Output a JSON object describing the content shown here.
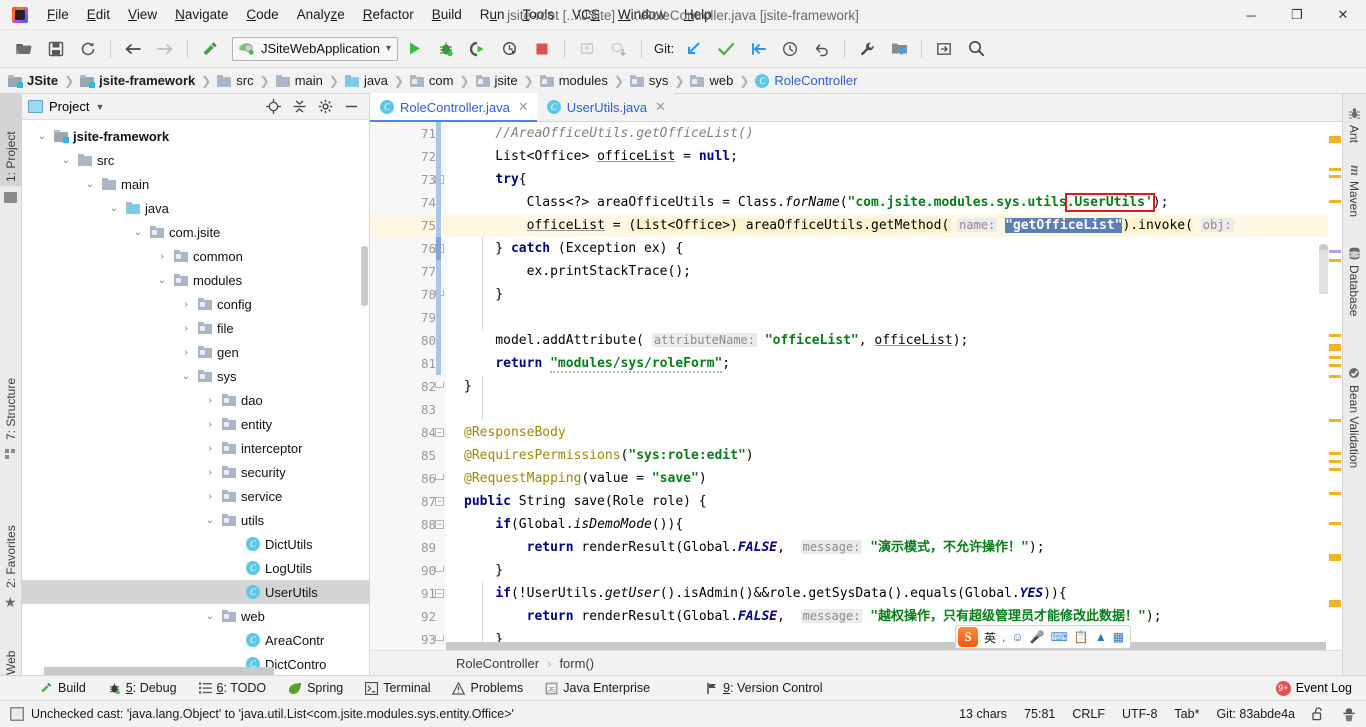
{
  "window": {
    "title": "jsite-root [...\\JSite] - ...\\RoleController.java [jsite-framework]",
    "minimize": "─",
    "maximize": "❐",
    "close": "✕"
  },
  "menubar": [
    {
      "label": "File",
      "mnemonic": "F"
    },
    {
      "label": "Edit",
      "mnemonic": "E"
    },
    {
      "label": "View",
      "mnemonic": "V"
    },
    {
      "label": "Navigate",
      "mnemonic": "N"
    },
    {
      "label": "Code",
      "mnemonic": "C"
    },
    {
      "label": "Analyze",
      "mnemonic": "z"
    },
    {
      "label": "Refactor",
      "mnemonic": "R"
    },
    {
      "label": "Build",
      "mnemonic": "B"
    },
    {
      "label": "Run",
      "mnemonic": "u"
    },
    {
      "label": "Tools",
      "mnemonic": "T"
    },
    {
      "label": "VCS",
      "mnemonic": "S"
    },
    {
      "label": "Window",
      "mnemonic": "W"
    },
    {
      "label": "Help",
      "mnemonic": "H"
    }
  ],
  "toolbar": {
    "run_config": "JSiteWebApplication",
    "git_label": "Git:",
    "icons": [
      "open-folder-icon",
      "save-all-icon",
      "sync-icon",
      "back-arrow-icon",
      "forward-arrow-icon",
      "build-hammer-icon"
    ],
    "run_icons": [
      "run-icon",
      "debug-icon",
      "run-with-coverage-icon",
      "profile-icon",
      "stop-icon",
      "attach-icon",
      "module-down-icon"
    ],
    "git_icons": [
      "update-project-icon",
      "commit-icon",
      "push-icon",
      "history-icon",
      "rollback-icon"
    ],
    "right_icons": [
      "settings-wrench-icon",
      "project-structure-icon",
      "select-in-icon",
      "search-everywhere-icon"
    ]
  },
  "breadcrumb": [
    {
      "label": "JSite",
      "icon": "module-folder-icon",
      "bold": true
    },
    {
      "label": "jsite-framework",
      "icon": "module-folder-icon",
      "bold": true
    },
    {
      "label": "src",
      "icon": "folder-icon"
    },
    {
      "label": "main",
      "icon": "folder-icon"
    },
    {
      "label": "java",
      "icon": "source-root-icon"
    },
    {
      "label": "com",
      "icon": "package-icon"
    },
    {
      "label": "jsite",
      "icon": "package-icon"
    },
    {
      "label": "modules",
      "icon": "package-icon"
    },
    {
      "label": "sys",
      "icon": "package-icon"
    },
    {
      "label": "web",
      "icon": "package-icon"
    },
    {
      "label": "RoleController",
      "icon": "class-icon",
      "blue": true
    }
  ],
  "left_strip": [
    {
      "label": "1: Project",
      "selected": true
    },
    {
      "label": "7: Structure",
      "selected": false
    },
    {
      "label": "2: Favorites",
      "selected": false
    },
    {
      "label": "Web",
      "selected": false
    }
  ],
  "right_strip": [
    {
      "label": "Ant",
      "icon": "ant-icon"
    },
    {
      "label": "Maven",
      "icon": "maven-icon"
    },
    {
      "label": "Database",
      "icon": "database-icon"
    },
    {
      "label": "Bean Validation",
      "icon": "bean-validation-icon"
    }
  ],
  "project_panel": {
    "title": "Project",
    "header_icons": [
      "locate-icon",
      "collapse-all-icon",
      "settings-gear-icon",
      "hide-icon"
    ],
    "tree": [
      {
        "label": "jsite-framework",
        "depth": 1,
        "twist": "down",
        "icon": "module-folder-icon",
        "bold": true,
        "selected": false
      },
      {
        "label": "src",
        "depth": 2,
        "twist": "down",
        "icon": "folder-icon",
        "bold": false,
        "selected": false
      },
      {
        "label": "main",
        "depth": 3,
        "twist": "down",
        "icon": "folder-icon",
        "bold": false,
        "selected": false
      },
      {
        "label": "java",
        "depth": 4,
        "twist": "down",
        "icon": "source-root-icon",
        "bold": false,
        "selected": false
      },
      {
        "label": "com.jsite",
        "depth": 5,
        "twist": "down",
        "icon": "package-icon",
        "bold": false,
        "selected": false
      },
      {
        "label": "common",
        "depth": 6,
        "twist": "right",
        "icon": "package-icon",
        "bold": false,
        "selected": false
      },
      {
        "label": "modules",
        "depth": 6,
        "twist": "down",
        "icon": "package-icon",
        "bold": false,
        "selected": false
      },
      {
        "label": "config",
        "depth": 7,
        "twist": "right",
        "icon": "package-icon",
        "bold": false,
        "selected": false
      },
      {
        "label": "file",
        "depth": 7,
        "twist": "right",
        "icon": "package-icon",
        "bold": false,
        "selected": false
      },
      {
        "label": "gen",
        "depth": 7,
        "twist": "right",
        "icon": "package-icon",
        "bold": false,
        "selected": false
      },
      {
        "label": "sys",
        "depth": 7,
        "twist": "down",
        "icon": "package-icon",
        "bold": false,
        "selected": false
      },
      {
        "label": "dao",
        "depth": 8,
        "twist": "right",
        "icon": "package-icon",
        "bold": false,
        "selected": false
      },
      {
        "label": "entity",
        "depth": 8,
        "twist": "right",
        "icon": "package-icon",
        "bold": false,
        "selected": false
      },
      {
        "label": "interceptor",
        "depth": 8,
        "twist": "right",
        "icon": "package-icon",
        "bold": false,
        "selected": false
      },
      {
        "label": "security",
        "depth": 8,
        "twist": "right",
        "icon": "package-icon",
        "bold": false,
        "selected": false
      },
      {
        "label": "service",
        "depth": 8,
        "twist": "right",
        "icon": "package-icon",
        "bold": false,
        "selected": false
      },
      {
        "label": "utils",
        "depth": 8,
        "twist": "down",
        "icon": "package-icon",
        "bold": false,
        "selected": false
      },
      {
        "label": "DictUtils",
        "depth": 9,
        "twist": "none",
        "icon": "class-icon",
        "bold": false,
        "selected": false
      },
      {
        "label": "LogUtils",
        "depth": 9,
        "twist": "none",
        "icon": "class-icon",
        "bold": false,
        "selected": false
      },
      {
        "label": "UserUtils",
        "depth": 9,
        "twist": "none",
        "icon": "class-icon",
        "bold": false,
        "selected": true
      },
      {
        "label": "web",
        "depth": 8,
        "twist": "down",
        "icon": "package-icon",
        "bold": false,
        "selected": false
      },
      {
        "label": "AreaContr",
        "depth": 9,
        "twist": "none",
        "icon": "class-icon",
        "bold": false,
        "selected": false
      },
      {
        "label": "DictContro",
        "depth": 9,
        "twist": "none",
        "icon": "class-icon",
        "bold": false,
        "selected": false
      }
    ]
  },
  "editor": {
    "tabs": [
      {
        "label": "RoleController.java",
        "icon": "class-icon",
        "active": true,
        "close": "✕"
      },
      {
        "label": "UserUtils.java",
        "icon": "class-icon",
        "active": false,
        "close": "✕"
      }
    ],
    "breadcrumb": [
      "RoleController",
      "form()"
    ],
    "breadcrumb_sep": "›",
    "first_line": 71,
    "current_line": 75,
    "lines": [
      {
        "n": 71,
        "fold": "",
        "text": "        //AreaOfficeUtils.getOfficeList()"
      },
      {
        "n": 72,
        "fold": "",
        "text": "        List<Office> officeList = null;"
      },
      {
        "n": 73,
        "fold": "minus",
        "text": "        try{"
      },
      {
        "n": 74,
        "fold": "",
        "text": "            Class<?> areaOfficeUtils = Class.forName(\"com.jsite.modules.sys.utils.UserUtils');"
      },
      {
        "n": 75,
        "fold": "",
        "text": "            officeList = (List<Office>) areaOfficeUtils.getMethod( name: \"getOfficeList\").invoke( obj:"
      },
      {
        "n": 76,
        "fold": "minus",
        "text": "        } catch (Exception ex) {"
      },
      {
        "n": 77,
        "fold": "",
        "text": "            ex.printStackTrace();"
      },
      {
        "n": 78,
        "fold": "end",
        "text": "        }"
      },
      {
        "n": 79,
        "fold": "",
        "text": ""
      },
      {
        "n": 80,
        "fold": "",
        "text": "        model.addAttribute( attributeName: \"officeList\", officeList);"
      },
      {
        "n": 81,
        "fold": "",
        "text": "        return \"modules/sys/roleForm\";"
      },
      {
        "n": 82,
        "fold": "end",
        "text": "    }"
      },
      {
        "n": 83,
        "fold": "",
        "text": ""
      },
      {
        "n": 84,
        "fold": "minus",
        "text": "    @ResponseBody"
      },
      {
        "n": 85,
        "fold": "",
        "text": "    @RequiresPermissions(\"sys:role:edit\")"
      },
      {
        "n": 86,
        "fold": "end",
        "text": "    @RequestMapping(value = \"save\")"
      },
      {
        "n": 87,
        "fold": "minus",
        "text": "    public String save(Role role) {"
      },
      {
        "n": 88,
        "fold": "minus",
        "text": "        if(Global.isDemoMode()){"
      },
      {
        "n": 89,
        "fold": "",
        "text": "            return renderResult(Global.FALSE,  message: \"演示模式，不允许操作！\");"
      },
      {
        "n": 90,
        "fold": "end",
        "text": "        }"
      },
      {
        "n": 91,
        "fold": "minus",
        "text": "        if(!UserUtils.getUser().isAdmin()&&role.getSysData().equals(Global.YES)){"
      },
      {
        "n": 92,
        "fold": "",
        "text": "            return renderResult(Global.FALSE,  message: \"越权操作，只有超级管理员才能修改此数据！\");"
      },
      {
        "n": 93,
        "fold": "end",
        "text": "        }"
      }
    ],
    "selected_text": "getOfficeList",
    "error_highlight": ".UserUtils'"
  },
  "ime": {
    "logo": "S",
    "mode": "英",
    "icons": [
      "comma-icon",
      "emoji-icon",
      "mic-icon",
      "keyboard-icon",
      "clipboard-icon",
      "umbrella-icon",
      "apps-icon"
    ]
  },
  "bottom_bar": {
    "items": [
      {
        "label": "Build",
        "mnemonic": "",
        "icon": "build-hammer-icon"
      },
      {
        "label": "5: Debug",
        "mnemonic": "5",
        "icon": "debug-bug-icon"
      },
      {
        "label": "6: TODO",
        "mnemonic": "6",
        "icon": "todo-list-icon"
      },
      {
        "label": "Spring",
        "mnemonic": "",
        "icon": "spring-leaf-icon"
      },
      {
        "label": "Terminal",
        "mnemonic": "",
        "icon": "terminal-icon"
      },
      {
        "label": "Problems",
        "mnemonic": "",
        "icon": "warning-triangle-icon"
      },
      {
        "label": "Java Enterprise",
        "mnemonic": "",
        "icon": "java-enterprise-icon"
      },
      {
        "label": "9: Version Control",
        "mnemonic": "9",
        "icon": "vcs-branch-icon"
      }
    ],
    "event_log": {
      "label": "Event Log",
      "badge": "9+"
    }
  },
  "status_bar": {
    "message": "Unchecked cast: 'java.lang.Object' to 'java.util.List<com.jsite.modules.sys.entity.Office>'",
    "message_icon": "inspection-icon",
    "chars": "13 chars",
    "caret": "75:81",
    "line_sep": "CRLF",
    "encoding": "UTF-8",
    "indent": "Tab*",
    "git_branch": "Git: 83abde4a",
    "lock_icon": "unlocked-icon",
    "hector_icon": "hector-inspection-icon"
  },
  "colors": {
    "accent_blue": "#2f5fd0",
    "tab_underline": "#4386f7",
    "string_green": "#067d17",
    "keyword_navy": "#000080",
    "annotation_gold": "#9e880d",
    "error_red": "#e01b1b",
    "selection_blue": "#5a7fb5",
    "current_line": "#fdf7e3",
    "marker_gold": "#f0b323",
    "panel_bg": "#f2f2f2"
  }
}
